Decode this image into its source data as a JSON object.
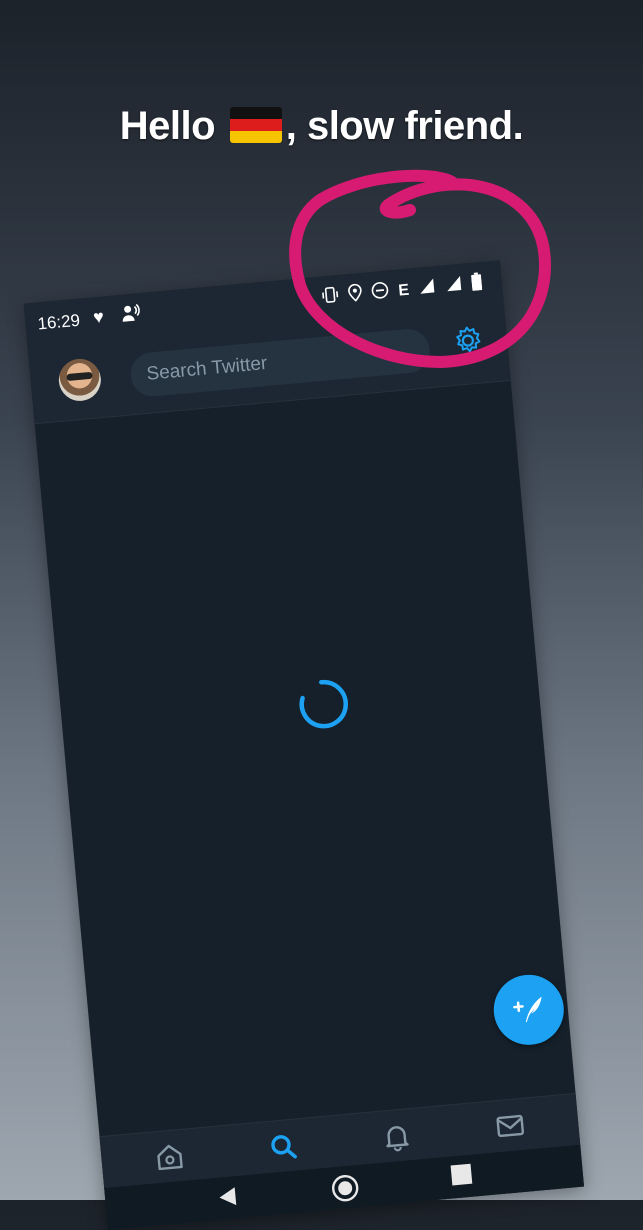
{
  "caption": {
    "before": "Hello",
    "after": ", slow friend."
  },
  "status_bar": {
    "time": "16:29",
    "network_label": "E"
  },
  "header": {
    "search_placeholder": "Search Twitter"
  },
  "colors": {
    "accent": "#1da1f2",
    "annotation": "#d81b72",
    "background": "#15202b"
  },
  "icons": {
    "settings": "gear-icon",
    "compose": "compose-tweet-icon",
    "home": "home-icon",
    "search": "search-icon",
    "notifications": "bell-icon",
    "messages": "mail-icon",
    "back": "back-triangle-icon",
    "home_button": "home-circle-icon",
    "recents": "recents-square-icon"
  }
}
